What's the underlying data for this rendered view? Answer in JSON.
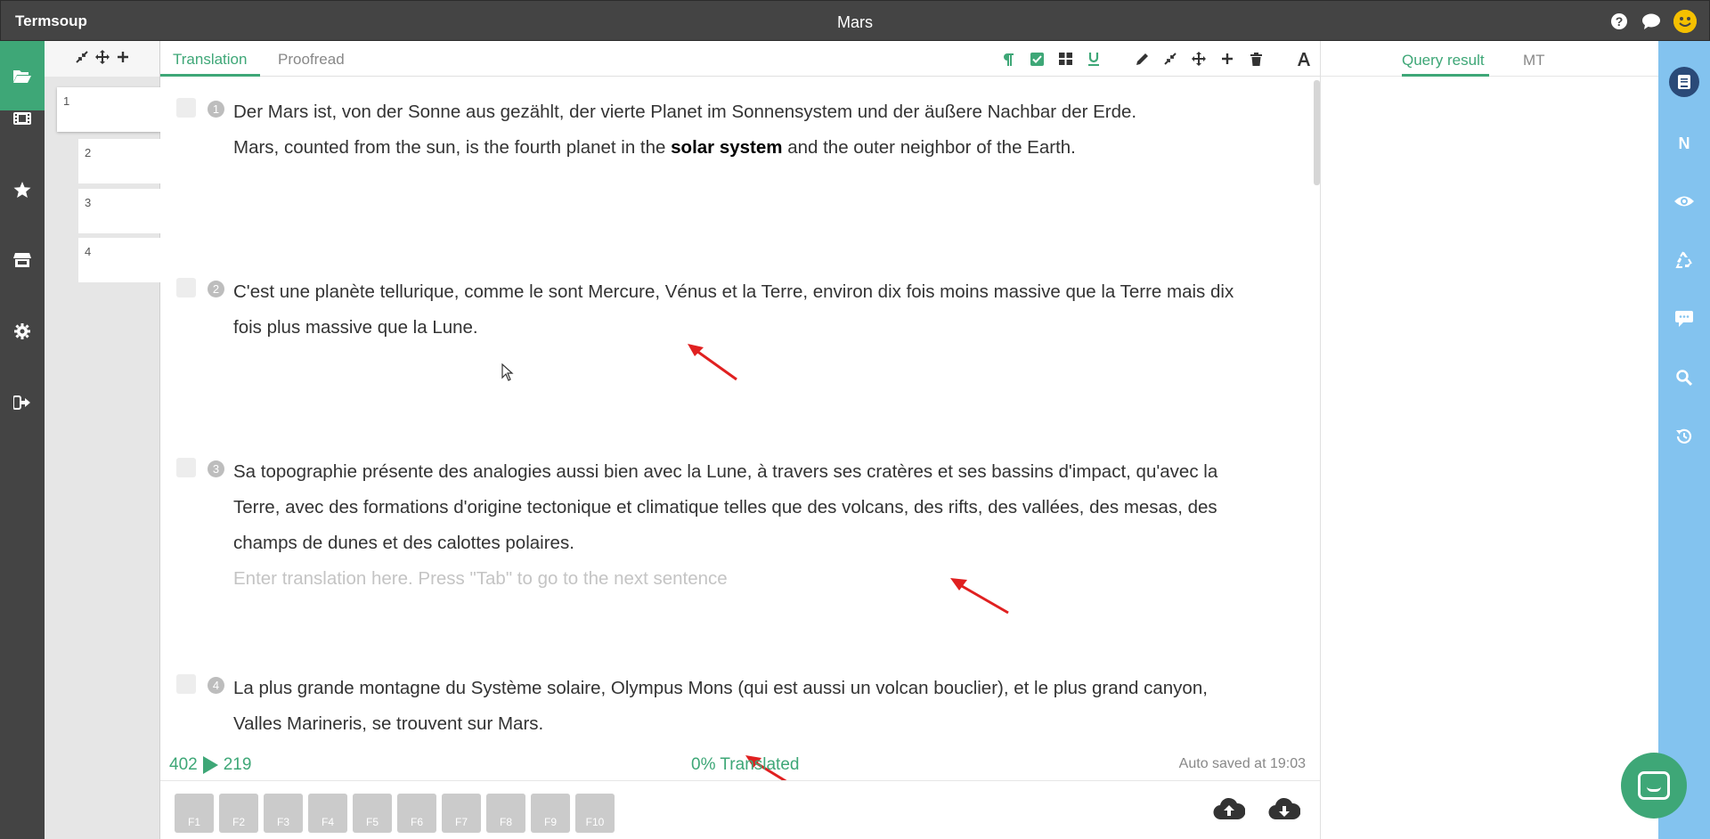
{
  "app": {
    "name": "Termsoup",
    "doc_title": "Mars"
  },
  "colors": {
    "accent": "#3ea777",
    "topbar": "#444444",
    "rail": "#83c3ef",
    "annotation_arrow": "#e02020"
  },
  "top_icons": [
    "help-icon",
    "chat-icon",
    "smiley-avatar"
  ],
  "left_nav": [
    "folder-open-icon",
    "film-icon",
    "star-icon",
    "store-icon",
    "gear-icon",
    "sign-out-icon"
  ],
  "minimap": {
    "tools": [
      "compress-icon",
      "move-icon",
      "plus-icon"
    ],
    "pages": [
      "1",
      "2",
      "3",
      "4"
    ]
  },
  "tabs": {
    "translation": "Translation",
    "proofread": "Proofread"
  },
  "toolbar": [
    "paragraph-icon",
    "checkbox-icon",
    "grid-icon",
    "underline-icon",
    "pencil-icon",
    "compress-icon",
    "move-icon",
    "plus-icon",
    "trash-icon",
    "font-icon"
  ],
  "segments": [
    {
      "num": "1",
      "source": "Der Mars ist, von der Sonne aus gezählt, der vierte Planet im Sonnensystem und der äußere Nachbar der Erde.",
      "trans_before": "Mars, counted from the sun, is the fourth planet in the ",
      "trans_bold": "solar system",
      "trans_after": " and the outer neighbor of the Earth."
    },
    {
      "num": "2",
      "source": "C'est une planète tellurique, comme le sont Mercure, Vénus et la Terre, environ dix fois moins massive que la Terre mais dix fois plus massive que la Lune."
    },
    {
      "num": "3",
      "source": "Sa topographie présente des analogies aussi bien avec la Lune, à travers ses cratères et ses bassins d'impact, qu'avec la Terre, avec des formations d'origine tectonique et climatique telles que des volcans, des rifts, des vallées, des mesas, des champs de dunes et des calottes polaires.",
      "placeholder": "Enter translation here. Press \"Tab\" to go to the next sentence"
    },
    {
      "num": "4",
      "source": "La plus grande montagne du Système solaire, Olympus Mons (qui est aussi un volcan bouclier), et le plus grand canyon, Valles Marineris, se trouvent sur Mars."
    }
  ],
  "status": {
    "chars_source": "402",
    "chars_target": "219",
    "translated": "0% Translated",
    "autosave": "Auto saved at 19:03"
  },
  "fkeys": [
    "F1",
    "F2",
    "F3",
    "F4",
    "F5",
    "F6",
    "F7",
    "F8",
    "F9",
    "F10"
  ],
  "right_panel": {
    "tabs": [
      "Query result",
      "MT"
    ]
  },
  "right_rail": {
    "items": [
      "book-icon",
      "N",
      "eye-icon",
      "recycle-icon",
      "comment-icon",
      "search-icon",
      "history-icon"
    ]
  }
}
